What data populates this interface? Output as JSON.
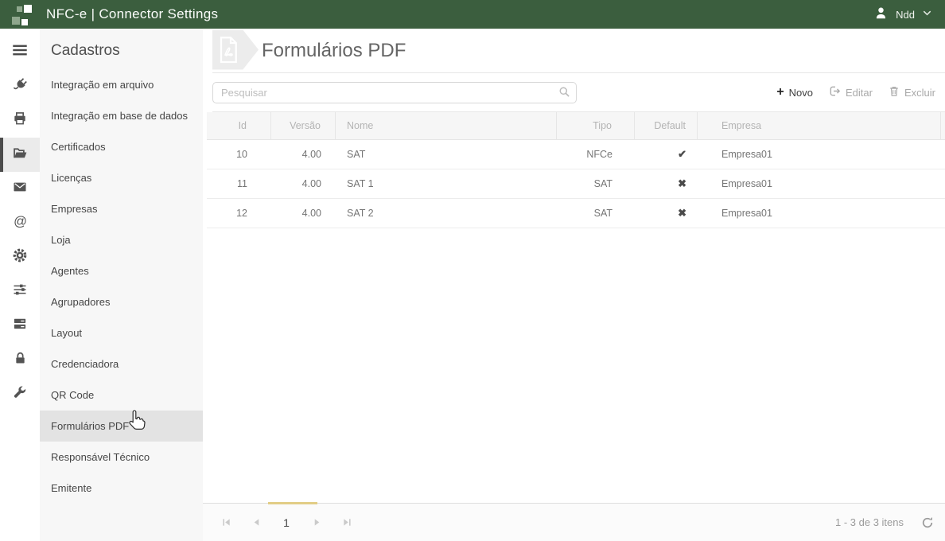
{
  "colors": {
    "topbar_bg": "#3b5e3e",
    "accent_tan": "#e2cd86",
    "rail_active_border": "#4c4c4c"
  },
  "topbar": {
    "title": "NFC-e | Connector Settings",
    "user_name": "Ndd"
  },
  "rail": {
    "items": [
      {
        "icon": "menu-icon"
      },
      {
        "icon": "plug-icon"
      },
      {
        "icon": "printer-icon"
      },
      {
        "icon": "folder-open-icon",
        "active": true
      },
      {
        "icon": "envelope-icon"
      },
      {
        "icon": "at-sign-icon"
      },
      {
        "icon": "gear-icon"
      },
      {
        "icon": "sliders-icon"
      },
      {
        "icon": "server-icon"
      },
      {
        "icon": "lock-icon"
      },
      {
        "icon": "wrench-icon"
      }
    ]
  },
  "sidebar": {
    "heading": "Cadastros",
    "items": [
      {
        "label": "Integração em arquivo"
      },
      {
        "label": "Integração em base de dados"
      },
      {
        "label": "Certificados"
      },
      {
        "label": "Licenças"
      },
      {
        "label": "Empresas"
      },
      {
        "label": "Loja"
      },
      {
        "label": "Agentes"
      },
      {
        "label": "Agrupadores"
      },
      {
        "label": "Layout"
      },
      {
        "label": "Credenciadora"
      },
      {
        "label": "QR Code"
      },
      {
        "label": "Formulários PDF",
        "active": true
      },
      {
        "label": "Responsável Técnico"
      },
      {
        "label": "Emitente"
      }
    ]
  },
  "page": {
    "title": "Formulários PDF"
  },
  "toolbar": {
    "search_placeholder": "Pesquisar",
    "new_label": "Novo",
    "edit_label": "Editar",
    "delete_label": "Excluir"
  },
  "table": {
    "columns": [
      {
        "label": "Id"
      },
      {
        "label": "Versão"
      },
      {
        "label": "Nome"
      },
      {
        "label": "Tipo"
      },
      {
        "label": "Default"
      },
      {
        "label": "Empresa"
      }
    ],
    "rows": [
      {
        "id": "10",
        "versao": "4.00",
        "nome": "SAT",
        "tipo": "NFCe",
        "default": "check",
        "empresa": "Empresa01"
      },
      {
        "id": "11",
        "versao": "4.00",
        "nome": "SAT 1",
        "tipo": "SAT",
        "default": "cross",
        "empresa": "Empresa01"
      },
      {
        "id": "12",
        "versao": "4.00",
        "nome": "SAT 2",
        "tipo": "SAT",
        "default": "cross",
        "empresa": "Empresa01"
      }
    ]
  },
  "pager": {
    "current_page": "1",
    "info": "1 - 3 de 3 itens"
  }
}
